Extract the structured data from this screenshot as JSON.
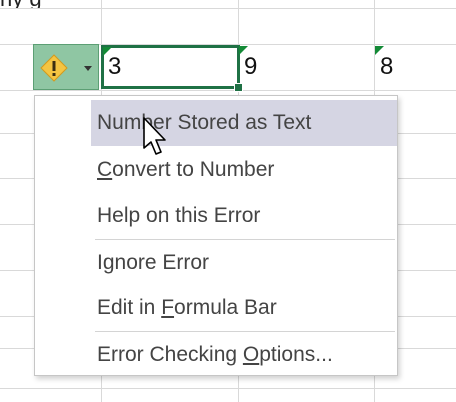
{
  "sheet": {
    "top_partial_text": "ny                                        g"
  },
  "cells": {
    "active_value": "3",
    "cell2_value": "9",
    "cell3_value": "8"
  },
  "smart_tag": {
    "icon": "warning-diamond-icon",
    "dropdown_icon": "caret-down-icon",
    "accent_color": "#8fc6a3",
    "warning_color": "#f4c542"
  },
  "menu": {
    "items": [
      {
        "label": "Number Stored as Text",
        "hover": true
      },
      {
        "pre": "",
        "key": "C",
        "post": "onvert to Number"
      },
      {
        "label": "Help on this Error"
      },
      {
        "label": "Ignore Error"
      },
      {
        "pre": "Edit in ",
        "key": "F",
        "post": "ormula Bar"
      },
      {
        "pre": "Error Checking ",
        "key": "O",
        "post": "ptions..."
      }
    ],
    "hover_color": "#d5d5e3"
  },
  "colors": {
    "active_border": "#1f7145",
    "error_triangle": "#138a36",
    "gridline": "#d9d9d9"
  }
}
